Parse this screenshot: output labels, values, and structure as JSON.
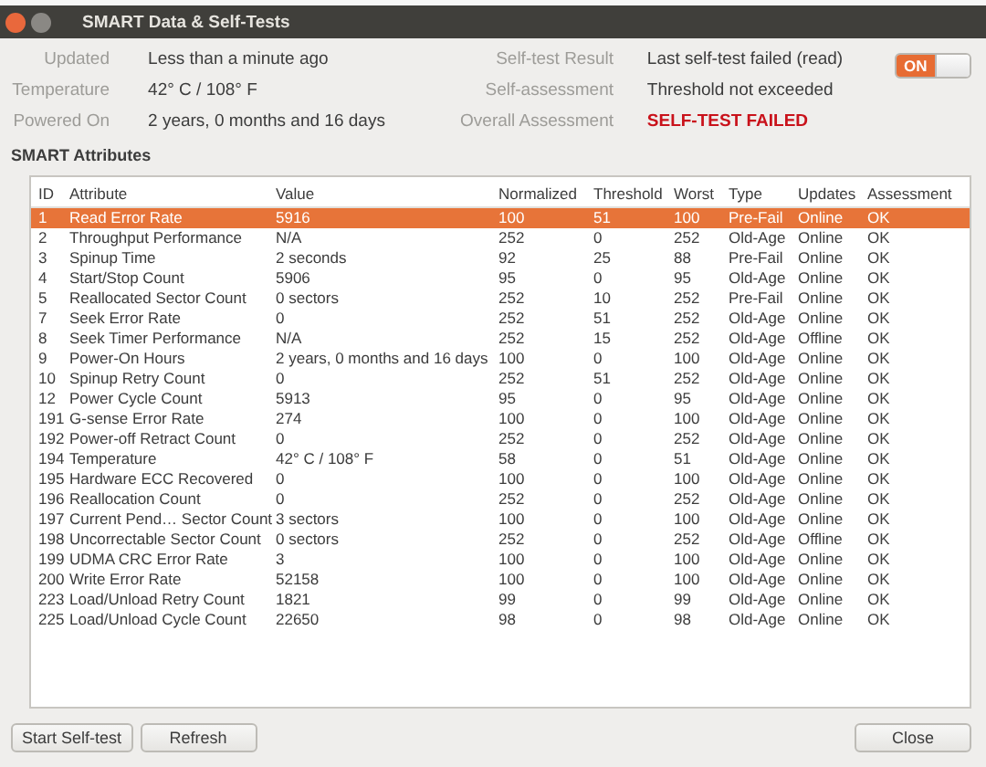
{
  "window": {
    "title": "SMART Data & Self-Tests"
  },
  "summary_left": [
    {
      "label": "Updated",
      "value": "Less than a minute ago",
      "alert": false
    },
    {
      "label": "Temperature",
      "value": "42° C / 108° F",
      "alert": false
    },
    {
      "label": "Powered On",
      "value": "2 years, 0 months and 16 days",
      "alert": false
    }
  ],
  "summary_right": [
    {
      "label": "Self-test Result",
      "value": "Last self-test failed (read)",
      "alert": false
    },
    {
      "label": "Self-assessment",
      "value": "Threshold not exceeded",
      "alert": false
    },
    {
      "label": "Overall Assessment",
      "value": "SELF-TEST FAILED",
      "alert": true
    }
  ],
  "smart_switch": {
    "label": "ON",
    "on": true
  },
  "section_title": "SMART Attributes",
  "table": {
    "columns": [
      "ID",
      "Attribute",
      "Value",
      "Normalized",
      "Threshold",
      "Worst",
      "Type",
      "Updates",
      "Assessment"
    ],
    "rows": [
      {
        "cells": [
          "1",
          "Read Error Rate",
          "5916",
          "100",
          "51",
          "100",
          "Pre-Fail",
          "Online",
          "OK"
        ],
        "selected": true
      },
      {
        "cells": [
          "2",
          "Throughput Performance",
          "N/A",
          "252",
          "0",
          "252",
          "Old-Age",
          "Online",
          "OK"
        ],
        "selected": false
      },
      {
        "cells": [
          "3",
          "Spinup Time",
          "2 seconds",
          "92",
          "25",
          "88",
          "Pre-Fail",
          "Online",
          "OK"
        ],
        "selected": false
      },
      {
        "cells": [
          "4",
          "Start/Stop Count",
          "5906",
          "95",
          "0",
          "95",
          "Old-Age",
          "Online",
          "OK"
        ],
        "selected": false
      },
      {
        "cells": [
          "5",
          "Reallocated Sector Count",
          "0 sectors",
          "252",
          "10",
          "252",
          "Pre-Fail",
          "Online",
          "OK"
        ],
        "selected": false
      },
      {
        "cells": [
          "7",
          "Seek Error Rate",
          "0",
          "252",
          "51",
          "252",
          "Old-Age",
          "Online",
          "OK"
        ],
        "selected": false
      },
      {
        "cells": [
          "8",
          "Seek Timer Performance",
          "N/A",
          "252",
          "15",
          "252",
          "Old-Age",
          "Offline",
          "OK"
        ],
        "selected": false
      },
      {
        "cells": [
          "9",
          "Power-On Hours",
          "2 years, 0 months and 16 days",
          "100",
          "0",
          "100",
          "Old-Age",
          "Online",
          "OK"
        ],
        "selected": false
      },
      {
        "cells": [
          "10",
          "Spinup Retry Count",
          "0",
          "252",
          "51",
          "252",
          "Old-Age",
          "Online",
          "OK"
        ],
        "selected": false
      },
      {
        "cells": [
          "12",
          "Power Cycle Count",
          "5913",
          "95",
          "0",
          "95",
          "Old-Age",
          "Online",
          "OK"
        ],
        "selected": false
      },
      {
        "cells": [
          "191",
          "G-sense Error Rate",
          "274",
          "100",
          "0",
          "100",
          "Old-Age",
          "Online",
          "OK"
        ],
        "selected": false
      },
      {
        "cells": [
          "192",
          "Power-off Retract Count",
          "0",
          "252",
          "0",
          "252",
          "Old-Age",
          "Online",
          "OK"
        ],
        "selected": false
      },
      {
        "cells": [
          "194",
          "Temperature",
          "42° C / 108° F",
          "58",
          "0",
          "51",
          "Old-Age",
          "Online",
          "OK"
        ],
        "selected": false
      },
      {
        "cells": [
          "195",
          "Hardware ECC Recovered",
          "0",
          "100",
          "0",
          "100",
          "Old-Age",
          "Online",
          "OK"
        ],
        "selected": false
      },
      {
        "cells": [
          "196",
          "Reallocation Count",
          "0",
          "252",
          "0",
          "252",
          "Old-Age",
          "Online",
          "OK"
        ],
        "selected": false
      },
      {
        "cells": [
          "197",
          "Current Pend… Sector Count",
          "3 sectors",
          "100",
          "0",
          "100",
          "Old-Age",
          "Online",
          "OK"
        ],
        "selected": false
      },
      {
        "cells": [
          "198",
          "Uncorrectable Sector Count",
          "0 sectors",
          "252",
          "0",
          "252",
          "Old-Age",
          "Offline",
          "OK"
        ],
        "selected": false
      },
      {
        "cells": [
          "199",
          "UDMA CRC Error Rate",
          "3",
          "100",
          "0",
          "100",
          "Old-Age",
          "Online",
          "OK"
        ],
        "selected": false
      },
      {
        "cells": [
          "200",
          "Write Error Rate",
          "52158",
          "100",
          "0",
          "100",
          "Old-Age",
          "Online",
          "OK"
        ],
        "selected": false
      },
      {
        "cells": [
          "223",
          "Load/Unload Retry Count",
          "1821",
          "99",
          "0",
          "99",
          "Old-Age",
          "Online",
          "OK"
        ],
        "selected": false
      },
      {
        "cells": [
          "225",
          "Load/Unload Cycle Count",
          "22650",
          "98",
          "0",
          "98",
          "Old-Age",
          "Online",
          "OK"
        ],
        "selected": false
      }
    ]
  },
  "buttons_left": [
    "Start Self-test",
    "Refresh"
  ],
  "buttons_right": [
    "Close"
  ]
}
